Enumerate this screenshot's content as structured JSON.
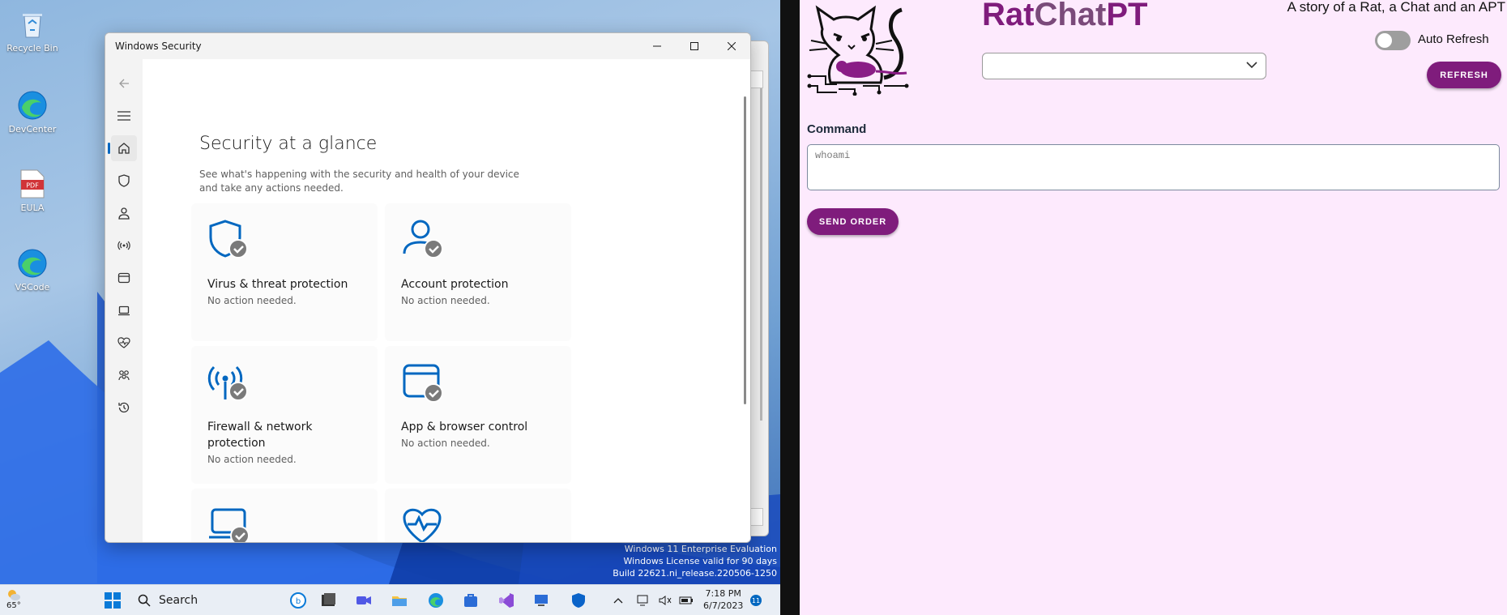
{
  "desktop": {
    "icons": [
      {
        "label": "Recycle Bin",
        "icon": "recycle-bin-icon"
      },
      {
        "label": "DevCenter",
        "icon": "edge-icon"
      },
      {
        "label": "EULA",
        "icon": "pdf-icon"
      },
      {
        "label": "VSCode",
        "icon": "edge-icon"
      }
    ],
    "watermark": [
      "Windows 11 Enterprise Evaluation",
      "Windows License valid for 90 days",
      "Build 22621.ni_release.220506-1250"
    ]
  },
  "security_window": {
    "title": "Windows Security",
    "page_title": "Security at a glance",
    "page_subtitle": "See what's happening with the security and health of your device and take any actions needed.",
    "accent": "#0067c0",
    "sidebar": [
      {
        "icon": "back-arrow-icon"
      },
      {
        "icon": "hamburger-menu-icon"
      },
      {
        "icon": "home-icon",
        "active": true
      },
      {
        "icon": "shield-icon"
      },
      {
        "icon": "person-icon"
      },
      {
        "icon": "wireless-signal-icon"
      },
      {
        "icon": "app-browser-icon"
      },
      {
        "icon": "laptop-icon"
      },
      {
        "icon": "heart-pulse-icon"
      },
      {
        "icon": "family-icon"
      },
      {
        "icon": "history-icon"
      }
    ],
    "cards": [
      {
        "title": "Virus & threat protection",
        "status": "No action needed."
      },
      {
        "title": "Account protection",
        "status": "No action needed."
      },
      {
        "title": "Firewall & network protection",
        "status": "No action needed."
      },
      {
        "title": "App & browser control",
        "status": "No action needed."
      }
    ]
  },
  "taskbar": {
    "weather": "65°",
    "search_label": "Search",
    "time": "7:18 PM",
    "date": "6/7/2023",
    "notification_count": "11"
  },
  "ratchat": {
    "brand": {
      "part1": "Rat",
      "part2": "Chat",
      "part3": "PT"
    },
    "tagline": "A story of a Rat, a Chat and an APT",
    "auto_refresh_label": "Auto Refresh",
    "auto_refresh_on": false,
    "refresh_label": "REFRESH",
    "command_label": "Command",
    "command_placeholder": "whoami",
    "send_label": "SEND ORDER",
    "colors": {
      "primary": "#7f1c7c",
      "background": "#fdeafd"
    }
  }
}
